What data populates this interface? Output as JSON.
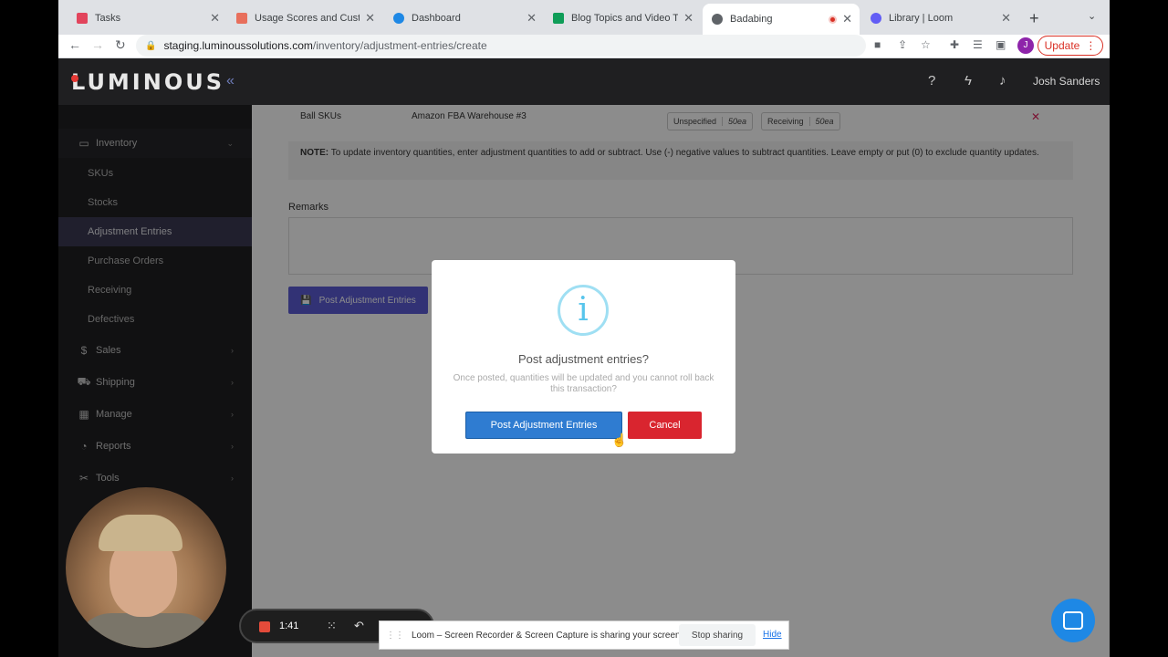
{
  "browser": {
    "tabs": [
      {
        "label": "Tasks",
        "color": "#e2445c"
      },
      {
        "label": "Usage Scores and Custome",
        "color": "#e86f5c"
      },
      {
        "label": "Dashboard",
        "color": "#1e88e5"
      },
      {
        "label": "Blog Topics and Video Tuto",
        "color": "#0f9d58"
      },
      {
        "label": "Badabing",
        "color": "#5f6368"
      },
      {
        "label": "Library | Loom",
        "color": "#625df5"
      }
    ],
    "url_host": "staging.luminoussolutions.com",
    "url_path": "/inventory/adjustment-entries/create",
    "profile_initial": "J",
    "update_label": "Update"
  },
  "app": {
    "logo": "LUMINOUS",
    "user_name": "Josh Sanders"
  },
  "sidebar": {
    "items": [
      {
        "label": "Inventory",
        "icon": "inventory-icon"
      },
      {
        "label": "SKUs"
      },
      {
        "label": "Stocks"
      },
      {
        "label": "Adjustment Entries"
      },
      {
        "label": "Purchase Orders"
      },
      {
        "label": "Receiving"
      },
      {
        "label": "Defectives"
      },
      {
        "label": "Sales",
        "icon": "sales-icon"
      },
      {
        "label": "Shipping",
        "icon": "shipping-icon"
      },
      {
        "label": "Manage",
        "icon": "manage-icon"
      },
      {
        "label": "Reports",
        "icon": "reports-icon"
      },
      {
        "label": "Tools",
        "icon": "tools-icon"
      }
    ]
  },
  "form": {
    "sku_name": "Ball SKUs",
    "warehouse": "Amazon FBA Warehouse #3",
    "chip1_label": "Unspecified",
    "chip1_value": "50ea",
    "chip2_label": "Receiving",
    "chip2_value": "50ea",
    "note_label": "NOTE:",
    "note_text": "To update inventory quantities, enter adjustment quantities to add or subtract. Use (-) negative values to subtract quantities. Leave empty or put (0) to exclude quantity updates.",
    "remarks_label": "Remarks",
    "post_button": "Post Adjustment Entries"
  },
  "modal": {
    "title": "Post adjustment entries?",
    "text": "Once posted, quantities will be updated and you cannot roll back this transaction?",
    "confirm_label": "Post Adjustment Entries",
    "cancel_label": "Cancel"
  },
  "loom": {
    "timer": "1:41",
    "share_text": "Loom – Screen Recorder & Screen Capture is sharing your screen.",
    "stop_label": "Stop sharing",
    "hide_label": "Hide"
  }
}
